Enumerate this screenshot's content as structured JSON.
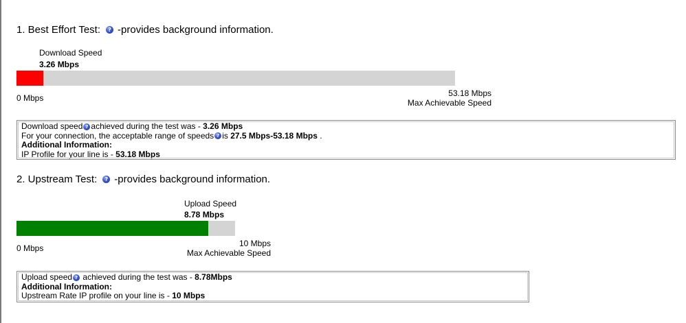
{
  "colors": {
    "download_bar": "#ff0000",
    "upload_bar": "#008000",
    "track": "#d4d4d4"
  },
  "best_effort": {
    "title": "1. Best Effort Test:",
    "subtitle": "-provides background information.",
    "help_icon": "question-icon",
    "speed_label": "Download Speed",
    "speed_value": "3.26 Mbps",
    "bar_fraction": 0.0613,
    "min_label": "0 Mbps",
    "max_value": "53.18 Mbps",
    "max_caption": "Max Achievable Speed",
    "info": {
      "line1_prefix": "Download speed",
      "line1_mid": "achieved during the test was - ",
      "line1_value": "3.26 Mbps",
      "line2_prefix": "For your connection, the acceptable range of speeds",
      "line2_mid": "is ",
      "line2_value": "27.5 Mbps-53.18 Mbps",
      "line2_suffix": " .",
      "additional": "Additional Information:",
      "line4_prefix": "IP Profile for your line is - ",
      "line4_value": "53.18 Mbps"
    }
  },
  "upstream": {
    "title": "2. Upstream Test:",
    "subtitle": "-provides background information.",
    "help_icon": "question-icon",
    "speed_label": "Upload Speed",
    "speed_value": "8.78 Mbps",
    "bar_fraction": 0.878,
    "min_label": "0 Mbps",
    "max_value": "10 Mbps",
    "max_caption": "Max Achievable Speed",
    "info": {
      "line1_prefix": "Upload speed",
      "line1_mid": " achieved during the test was - ",
      "line1_value": "8.78Mbps",
      "additional": "Additional Information:",
      "line3_prefix": "Upstream Rate IP profile on your line is - ",
      "line3_value": "10 Mbps"
    }
  }
}
